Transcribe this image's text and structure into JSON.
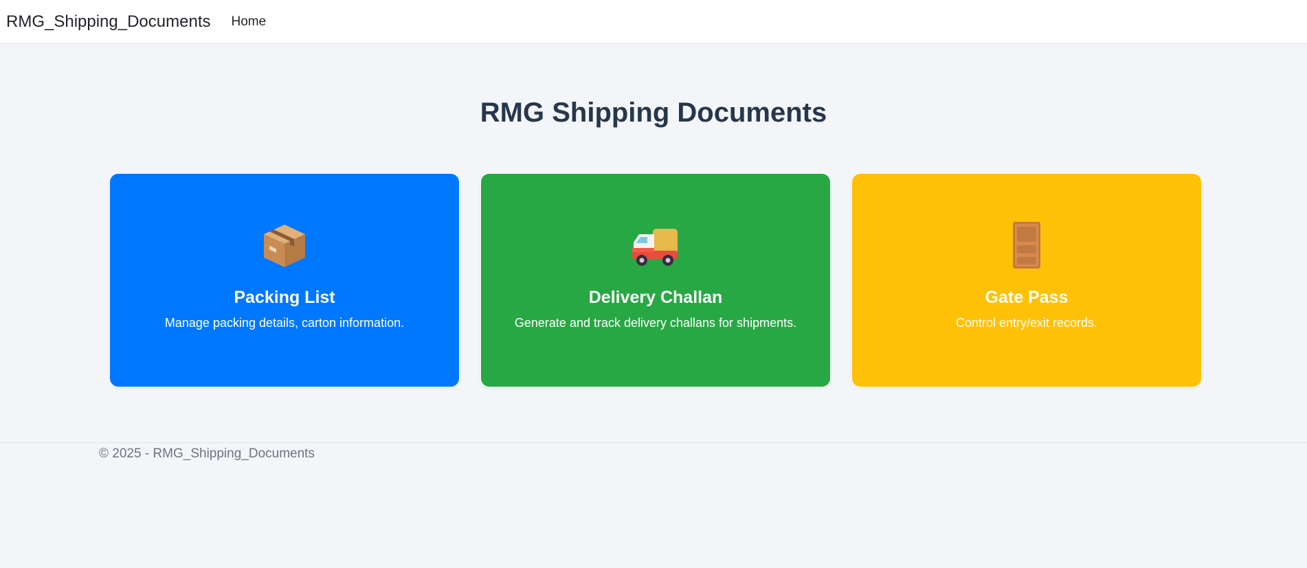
{
  "navbar": {
    "brand": "RMG_Shipping_Documents",
    "links": [
      "Home"
    ]
  },
  "page": {
    "title": "RMG Shipping Documents"
  },
  "cards": [
    {
      "title": "Packing List",
      "description": "Manage packing details, carton information.",
      "icon": "package-icon",
      "color": "#0077ff"
    },
    {
      "title": "Delivery Challan",
      "description": "Generate and track delivery challans for shipments.",
      "icon": "delivery-truck-icon",
      "color": "#28a745"
    },
    {
      "title": "Gate Pass",
      "description": "Control entry/exit records.",
      "icon": "door-icon",
      "color": "#ffc107"
    }
  ],
  "footer": {
    "text": "© 2025 - RMG_Shipping_Documents"
  }
}
